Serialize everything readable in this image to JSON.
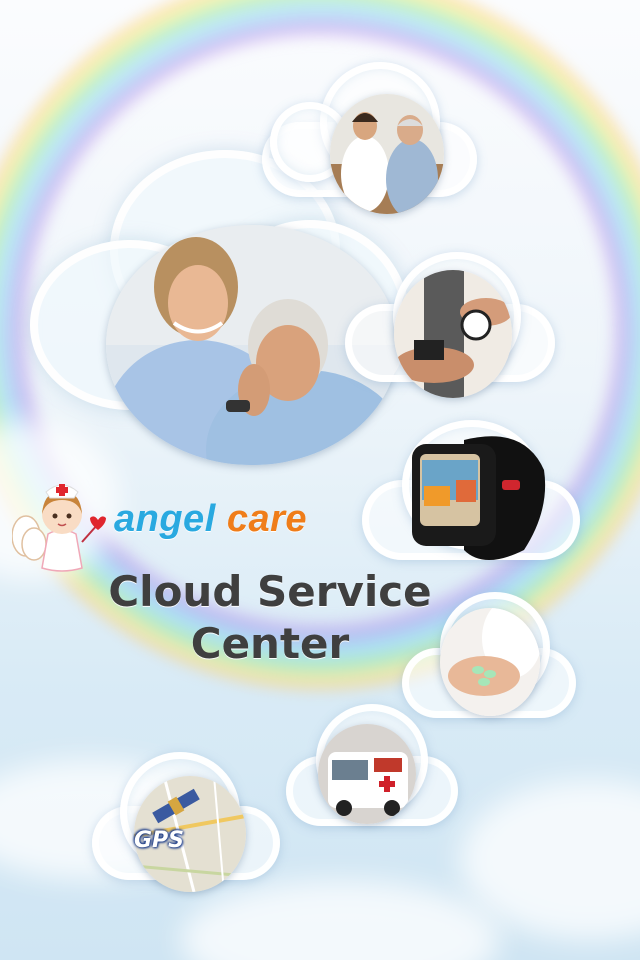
{
  "brand": {
    "angel": "angel",
    "care": "care",
    "angel_color": "#29a9e0",
    "care_color": "#ef7d1a"
  },
  "title": {
    "line1": "Cloud Service",
    "line2": "Center"
  },
  "gps": {
    "label": "GPS"
  },
  "images": [
    "nurse-angel-mascot",
    "elderly-couple-photo",
    "doctor-consultation-photo",
    "blood-pressure-photo",
    "smart-watch-photo",
    "medicine-pills-photo",
    "ambulance-photo",
    "gps-satellite-map"
  ],
  "colors": {
    "title_text": "#3f3f3f",
    "sky": "#d9ebf6"
  }
}
